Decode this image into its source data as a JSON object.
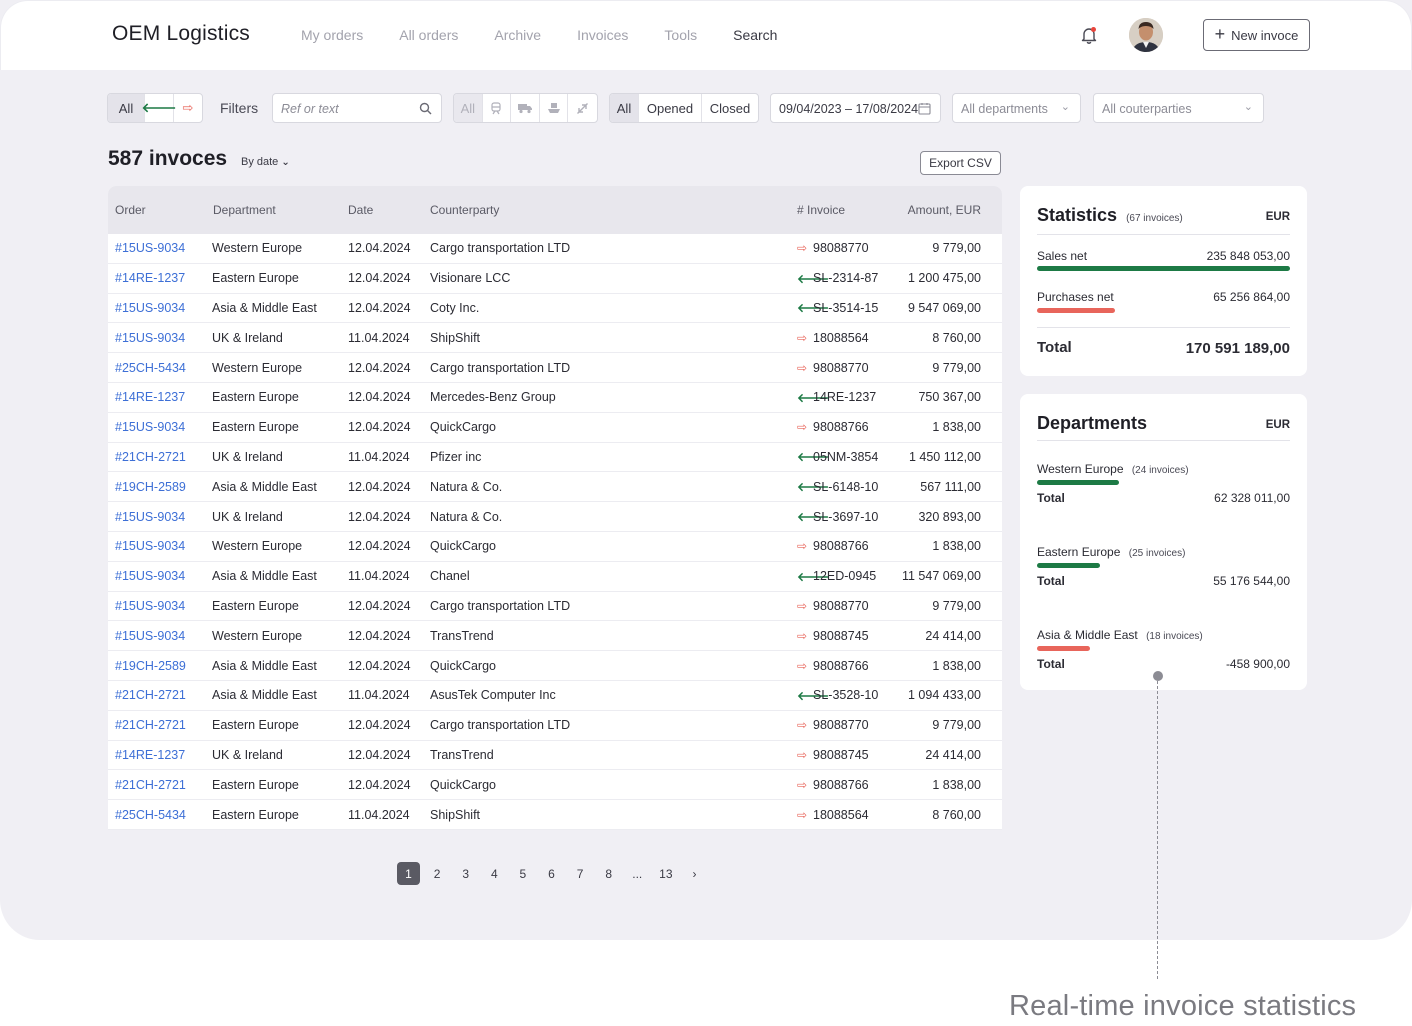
{
  "app": {
    "brand": "OEM Logistics",
    "nav": [
      "My orders",
      "All orders",
      "Archive",
      "Invoices",
      "Tools",
      "Search"
    ],
    "new_button": "New invoce"
  },
  "filters": {
    "direction": [
      "All"
    ],
    "label": "Filters",
    "search_placeholder": "Ref or text",
    "mode_all": "All",
    "status": [
      "All",
      "Opened",
      "Closed"
    ],
    "date_range": "09/04/2023 – 17/08/2024",
    "departments": "All departments",
    "counterparties": "All couterparties"
  },
  "header": {
    "title": "587 invoces",
    "sort": "By date",
    "export": "Export CSV"
  },
  "table": {
    "columns": [
      "Order",
      "Department",
      "Date",
      "Counterparty",
      "# Invoice",
      "Amount, EUR"
    ],
    "rows": [
      {
        "order": "#15US-9034",
        "dept": "Western Europe",
        "date": "12.04.2024",
        "cp": "Cargo transportation LTD",
        "dir": "out",
        "inv": "98088770",
        "amt": "9 779,00"
      },
      {
        "order": "#14RE-1237",
        "dept": "Eastern Europe",
        "date": "12.04.2024",
        "cp": "Visionare LCC",
        "dir": "in",
        "inv": "SL-2314-87",
        "amt": "1 200 475,00"
      },
      {
        "order": "#15US-9034",
        "dept": "Asia & Middle East",
        "date": "12.04.2024",
        "cp": "Coty Inc.",
        "dir": "in",
        "inv": "SL-3514-15",
        "amt": "9 547 069,00"
      },
      {
        "order": "#15US-9034",
        "dept": "UK & Ireland",
        "date": "11.04.2024",
        "cp": "ShipShift",
        "dir": "out",
        "inv": "18088564",
        "amt": "8 760,00"
      },
      {
        "order": "#25CH-5434",
        "dept": "Western Europe",
        "date": "12.04.2024",
        "cp": "Cargo transportation LTD",
        "dir": "out",
        "inv": "98088770",
        "amt": "9 779,00"
      },
      {
        "order": "#14RE-1237",
        "dept": "Eastern Europe",
        "date": "12.04.2024",
        "cp": "Mercedes-Benz Group",
        "dir": "in",
        "inv": "14RE-1237",
        "amt": "750 367,00"
      },
      {
        "order": "#15US-9034",
        "dept": "Eastern Europe",
        "date": "12.04.2024",
        "cp": "QuickCargo",
        "dir": "out",
        "inv": "98088766",
        "amt": "1 838,00"
      },
      {
        "order": "#21CH-2721",
        "dept": "UK & Ireland",
        "date": "11.04.2024",
        "cp": "Pfizer inc",
        "dir": "in",
        "inv": "05NM-3854",
        "amt": "1 450 112,00"
      },
      {
        "order": "#19CH-2589",
        "dept": "Asia & Middle East",
        "date": "12.04.2024",
        "cp": "Natura & Co.",
        "dir": "in",
        "inv": "SL-6148-10",
        "amt": "567 111,00"
      },
      {
        "order": "#15US-9034",
        "dept": "UK & Ireland",
        "date": "12.04.2024",
        "cp": "Natura & Co.",
        "dir": "in",
        "inv": "SL-3697-10",
        "amt": "320 893,00"
      },
      {
        "order": "#15US-9034",
        "dept": "Western Europe",
        "date": "12.04.2024",
        "cp": "QuickCargo",
        "dir": "out",
        "inv": "98088766",
        "amt": "1 838,00"
      },
      {
        "order": "#15US-9034",
        "dept": "Asia & Middle East",
        "date": "11.04.2024",
        "cp": "Chanel",
        "dir": "in",
        "inv": "12ED-0945",
        "amt": "11 547 069,00"
      },
      {
        "order": "#15US-9034",
        "dept": "Eastern Europe",
        "date": "12.04.2024",
        "cp": "Cargo transportation LTD",
        "dir": "out",
        "inv": "98088770",
        "amt": "9 779,00"
      },
      {
        "order": "#15US-9034",
        "dept": "Western Europe",
        "date": "12.04.2024",
        "cp": "TransTrend",
        "dir": "out",
        "inv": "98088745",
        "amt": "24 414,00"
      },
      {
        "order": "#19CH-2589",
        "dept": "Asia & Middle East",
        "date": "12.04.2024",
        "cp": "QuickCargo",
        "dir": "out",
        "inv": "98088766",
        "amt": "1 838,00"
      },
      {
        "order": "#21CH-2721",
        "dept": "Asia & Middle East",
        "date": "11.04.2024",
        "cp": "AsusTek Computer Inc",
        "dir": "in",
        "inv": "SL-3528-10",
        "amt": "1 094 433,00"
      },
      {
        "order": "#21CH-2721",
        "dept": "Eastern Europe",
        "date": "12.04.2024",
        "cp": "Cargo transportation LTD",
        "dir": "out",
        "inv": "98088770",
        "amt": "9 779,00"
      },
      {
        "order": "#14RE-1237",
        "dept": "UK & Ireland",
        "date": "12.04.2024",
        "cp": "TransTrend",
        "dir": "out",
        "inv": "98088745",
        "amt": "24 414,00"
      },
      {
        "order": "#21CH-2721",
        "dept": "Eastern Europe",
        "date": "12.04.2024",
        "cp": "QuickCargo",
        "dir": "out",
        "inv": "98088766",
        "amt": "1 838,00"
      },
      {
        "order": "#25CH-5434",
        "dept": "Eastern Europe",
        "date": "11.04.2024",
        "cp": "ShipShift",
        "dir": "out",
        "inv": "18088564",
        "amt": "8 760,00"
      }
    ]
  },
  "pagination": {
    "pages": [
      "1",
      "2",
      "3",
      "4",
      "5",
      "6",
      "7",
      "8",
      "...",
      "13"
    ],
    "current": "1",
    "next": "›"
  },
  "statistics": {
    "title": "Statistics",
    "sub": "(67 invoices)",
    "currency": "EUR",
    "sales_label": "Sales net",
    "sales_value": "235 848 053,00",
    "sales_ratio": 1.0,
    "purchases_label": "Purchases net",
    "purchases_value": "65 256 864,00",
    "purchases_ratio": 0.31,
    "total_label": "Total",
    "total_value": "170 591 189,00"
  },
  "departments": {
    "title": "Departments",
    "currency": "EUR",
    "items": [
      {
        "name": "Western Europe",
        "sub": "(24 invoices)",
        "total_label": "Total",
        "total": "62 328 011,00"
      },
      {
        "name": "Eastern Europe",
        "sub": "(25 invoices)",
        "total_label": "Total",
        "total": "55 176 544,00"
      },
      {
        "name": "Asia & Middle East",
        "sub": "(18 invoices)",
        "total_label": "Total",
        "total": "-458 900,00"
      }
    ]
  },
  "caption": "Real-time invoice statistics",
  "colors": {
    "positive": "#1d7a45",
    "negative": "#e8655b",
    "link": "#3d6fd6"
  }
}
